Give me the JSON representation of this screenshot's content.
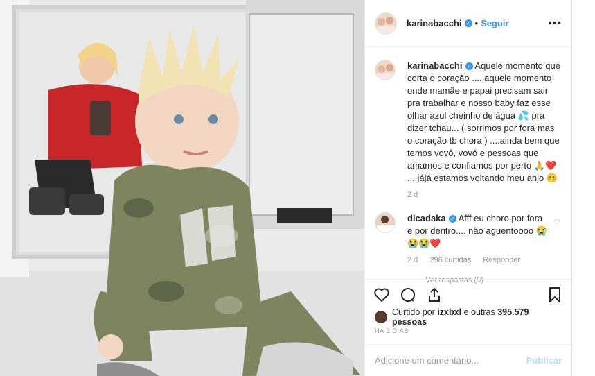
{
  "post": {
    "username": "karinabacchi",
    "verified_icon": "verified-badge-icon",
    "separator": "•",
    "follow_label": "Seguir",
    "more_label": "•••",
    "caption": "Aquele momento que corta o coração .... aquele momento onde mamãe e papai precisam sair pra trabalhar e nosso baby faz esse olhar azul cheinho de água 💦 pra dizer tchau... ( sorrimos por fora mas o coração tb chora ) ....ainda bem que temos vovô, vovó e pessoas que amamos e confiamos por perto 🙏❤️ ... jájá estamos voltando meu anjo 😊",
    "caption_age": "2 d"
  },
  "comment": {
    "username": "dicadaka",
    "text": "Afff eu choro por fora e por dentro.... não aguentoooo 😭😭😭❤️",
    "age": "2 d",
    "likes": "296 curtidas",
    "reply_label": "Responder",
    "view_replies": "Ver respostas (5)"
  },
  "engagement": {
    "liked_by": "Curtido por",
    "liked_user": "izxbxl",
    "and_others": "e outras",
    "count": "395.579",
    "people": "pessoas",
    "timestamp": "HÁ 2 DIAS"
  },
  "composer": {
    "placeholder": "Adicione um comentário...",
    "publish_label": "Publicar"
  },
  "colors": {
    "accent": "#3897f0",
    "publish_disabled": "#b3dbff"
  }
}
